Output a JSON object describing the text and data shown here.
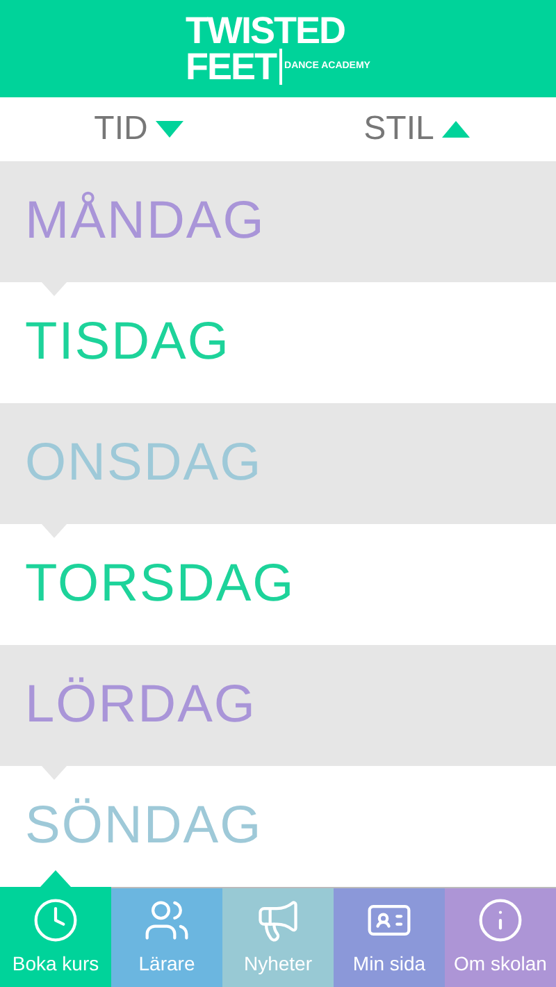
{
  "logo": {
    "line_1": "TWISTED",
    "line_2": "FEET",
    "tagline": "DANCE ACADEMY"
  },
  "sort": [
    {
      "label": "TID",
      "kind": "down"
    },
    {
      "label": "STIL",
      "kind": "up"
    }
  ],
  "days": [
    {
      "label": "MÅNDAG",
      "color": "#a995d8"
    },
    {
      "label": "TISDAG",
      "color": "#1dd39a"
    },
    {
      "label": "ONSDAG",
      "color": "#9ec9d8"
    },
    {
      "label": "TORSDAG",
      "color": "#1dd39a"
    },
    {
      "label": "LÖRDAG",
      "color": "#a995d8"
    },
    {
      "label": "SÖNDAG",
      "color": "#9ec9d8"
    }
  ],
  "tabs": [
    {
      "label": "Boka kurs",
      "kind": "clock",
      "color": "#00d39a",
      "selected": true
    },
    {
      "label": "Lärare",
      "kind": "people",
      "color": "#6bb6e0",
      "selected": false
    },
    {
      "label": "Nyheter",
      "kind": "megaphone",
      "color": "#98c9d4",
      "selected": false
    },
    {
      "label": "Min sida",
      "kind": "card",
      "color": "#8b98d9",
      "selected": false
    },
    {
      "label": "Om skolan",
      "kind": "info",
      "color": "#ad95d6",
      "selected": false
    }
  ]
}
